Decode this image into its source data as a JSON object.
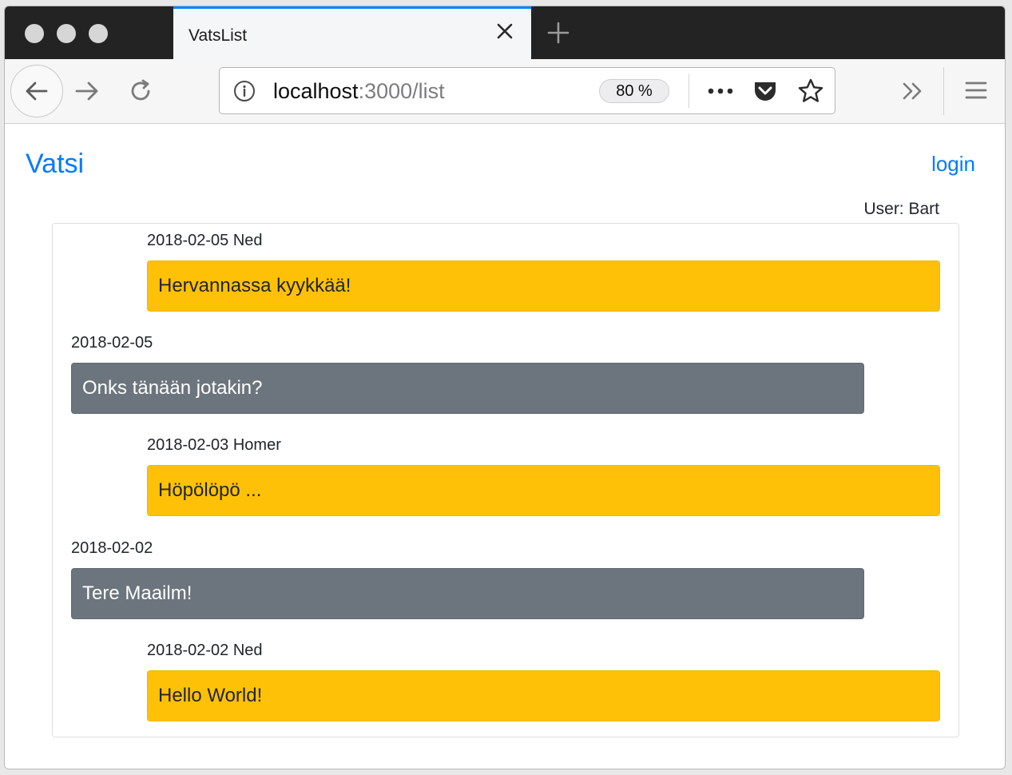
{
  "browser": {
    "tab_title": "VatsList",
    "url_host": "localhost",
    "url_path": ":3000/list",
    "zoom": "80 %",
    "icons": [
      "back-arrow-icon",
      "forward-arrow-icon",
      "reload-icon",
      "info-icon",
      "more-actions-icon",
      "pocket-icon",
      "star-icon",
      "overflow-chevron-icon",
      "hamburger-menu-icon",
      "close-icon",
      "plus-icon"
    ],
    "accent_color": "#0a84ff"
  },
  "app": {
    "brand": "Vatsi",
    "login_label": "login",
    "user_label": "User: Bart",
    "colors": {
      "link": "#007bff",
      "own_message": "#ffc107",
      "other_message": "#6c757d"
    }
  },
  "messages": [
    {
      "meta": "2018-02-05 Ned",
      "text": "Hervannassa kyykkää!",
      "kind": "own"
    },
    {
      "meta": "2018-02-05",
      "text": "Onks tänään jotakin?",
      "kind": "other"
    },
    {
      "meta": "2018-02-03 Homer",
      "text": "Höpölöpö ...",
      "kind": "own"
    },
    {
      "meta": "2018-02-02",
      "text": "Tere Maailm!",
      "kind": "other"
    },
    {
      "meta": "2018-02-02 Ned",
      "text": "Hello World!",
      "kind": "own"
    }
  ]
}
